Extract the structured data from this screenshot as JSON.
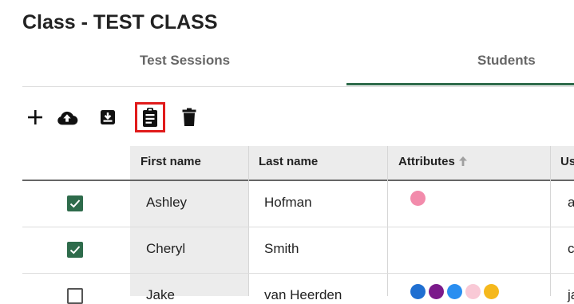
{
  "page": {
    "title": "Class - TEST CLASS"
  },
  "tabs": [
    {
      "label": "Test Sessions",
      "active": false
    },
    {
      "label": "Students",
      "active": true
    }
  ],
  "toolbar": {
    "icons": [
      "add-icon",
      "cloud-upload-icon",
      "import-icon",
      "clipboard-report-icon",
      "delete-icon"
    ],
    "highlighted": "clipboard-report-icon",
    "highlight_color": "#e01b1b"
  },
  "table": {
    "columns": [
      {
        "label": ""
      },
      {
        "label": "First name"
      },
      {
        "label": "Last name"
      },
      {
        "label": "Attributes",
        "sort": "ascending"
      },
      {
        "label": "Us"
      }
    ],
    "rows": [
      {
        "checked": true,
        "first_name": "Ashley",
        "last_name": "Hofman",
        "attributes": [
          "#f28bab"
        ],
        "username": "a"
      },
      {
        "checked": true,
        "first_name": "Cheryl",
        "last_name": "Smith",
        "attributes": [],
        "username": "c"
      },
      {
        "checked": false,
        "first_name": "Jake",
        "last_name": "van Heerden",
        "attributes": [
          "#1f6fd1",
          "#7b1a8a",
          "#2a8ef0",
          "#f9c9d6",
          "#f5b81c"
        ],
        "username": "ja"
      }
    ]
  },
  "colors": {
    "accent": "#2e6b4b",
    "checkbox": "#2e6b4b"
  }
}
